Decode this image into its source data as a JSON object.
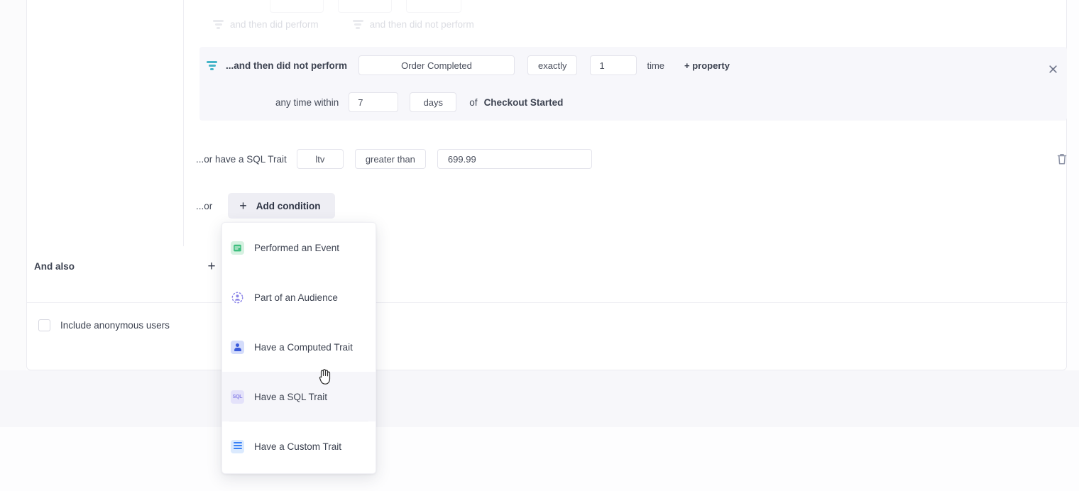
{
  "colors": {
    "accent_teal": "#45b4c8",
    "panel_highlight": "#f7f7fb",
    "button_bg": "#eeeef4",
    "text_primary": "#3d4351",
    "green": "#3fbf7f",
    "indigo": "#3b5bdb",
    "purple": "#8b84e8",
    "blue": "#3b82f6"
  },
  "ghost_row": {
    "link_perform": "and then did perform",
    "link_not_perform": "and then did not perform",
    "icon": "filter-icon"
  },
  "condition": {
    "icon": "filter-icon",
    "label": "...and then did not perform",
    "event": "Order Completed",
    "operator": "exactly",
    "count": "1",
    "count_unit": "time",
    "add_property": "+ property",
    "close_icon": "close-icon",
    "within_label": "any time within",
    "within_value": "7",
    "within_unit": "days",
    "of_label": "of",
    "of_event": "Checkout Started"
  },
  "sql_trait": {
    "label": "...or have a SQL Trait",
    "trait": "ltv",
    "operator": "greater than",
    "value": "699.99",
    "delete_icon": "trash-icon"
  },
  "add_condition": {
    "prefix": "...or",
    "plus": "+",
    "label": "Add condition"
  },
  "and_also": {
    "label": "And also",
    "plus": "+"
  },
  "anonymous": {
    "label": "Include anonymous users",
    "checked": false
  },
  "dropdown": {
    "items": [
      {
        "label": "Performed an Event",
        "icon": "event-icon",
        "active": false,
        "separator_below": false
      },
      {
        "label": "Part of an Audience",
        "icon": "audience-icon",
        "active": false,
        "separator_below": false
      },
      {
        "label": "Have a Computed Trait",
        "icon": "computed-trait-icon",
        "active": false,
        "separator_below": false
      },
      {
        "label": "Have a SQL Trait",
        "icon": "sql-trait-icon",
        "active": true,
        "separator_below": true
      },
      {
        "label": "Have a Custom Trait",
        "icon": "custom-trait-icon",
        "active": false,
        "separator_below": false
      }
    ]
  }
}
